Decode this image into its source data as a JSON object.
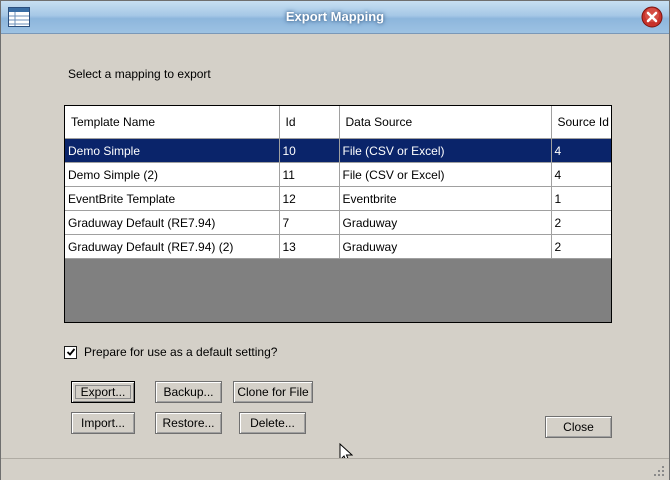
{
  "window": {
    "title": "Export Mapping"
  },
  "instruction": "Select a mapping to export",
  "table": {
    "columns": [
      "Template Name",
      "Id",
      "Data Source",
      "Source Id"
    ],
    "rows": [
      [
        "Demo Simple",
        "10",
        "File (CSV or Excel)",
        "4"
      ],
      [
        "Demo Simple (2)",
        "11",
        "File (CSV or Excel)",
        "4"
      ],
      [
        "EventBrite Template",
        "12",
        "Eventbrite",
        "1"
      ],
      [
        "Graduway Default (RE7.94)",
        "7",
        "Graduway",
        "2"
      ],
      [
        "Graduway Default (RE7.94) (2)",
        "13",
        "Graduway",
        "2"
      ]
    ],
    "selected_row": 0
  },
  "checkbox": {
    "label": "Prepare for use as a default setting?",
    "checked": true
  },
  "buttons": {
    "export": "Export...",
    "backup": "Backup...",
    "clone": "Clone for File",
    "import": "Import...",
    "restore": "Restore...",
    "delete": "Delete...",
    "close": "Close"
  },
  "icons": {
    "app": "grid-window-icon",
    "close": "close-x-icon",
    "cursor": "mouse-pointer-icon",
    "grip": "resize-grip-icon"
  }
}
